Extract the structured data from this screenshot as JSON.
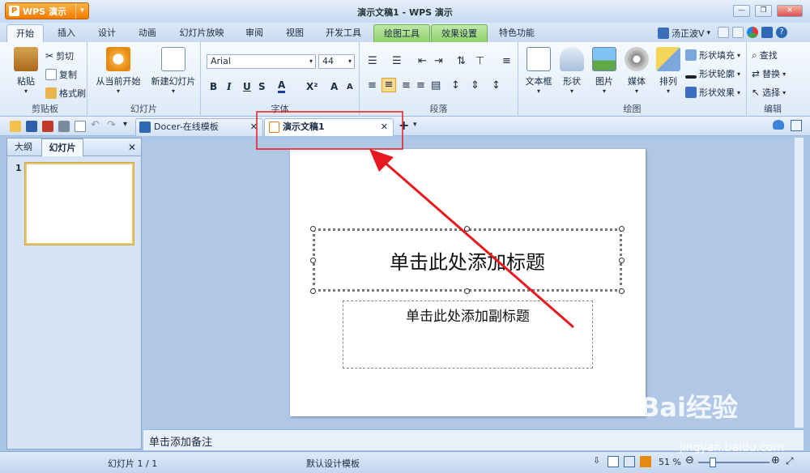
{
  "app": {
    "menu_label": "WPS 演示",
    "window_title": "演示文稿1 - WPS 演示"
  },
  "ribbon_tabs": [
    {
      "label": "开始"
    },
    {
      "label": "插入"
    },
    {
      "label": "设计"
    },
    {
      "label": "动画"
    },
    {
      "label": "幻灯片放映"
    },
    {
      "label": "审阅"
    },
    {
      "label": "视图"
    },
    {
      "label": "开发工具"
    },
    {
      "label": "绘图工具"
    },
    {
      "label": "效果设置"
    },
    {
      "label": "特色功能"
    }
  ],
  "user_name": "汤正波V",
  "groups": {
    "clipboard": {
      "label": "剪贴板",
      "paste": "粘贴",
      "cut": "剪切",
      "copy": "复制",
      "format_painter": "格式刷"
    },
    "slides": {
      "label": "幻灯片",
      "from_current": "从当前开始",
      "new_slide": "新建幻灯片"
    },
    "font": {
      "label": "字体",
      "font_name": "Arial",
      "font_size": "44"
    },
    "paragraph": {
      "label": "段落"
    },
    "drawing": {
      "label": "绘图",
      "textbox": "文本框",
      "shape": "形状",
      "picture": "图片",
      "media": "媒体",
      "arrange": "排列",
      "shape_fill": "形状填充",
      "shape_outline": "形状轮廓",
      "shape_effect": "形状效果"
    },
    "editing": {
      "label": "编辑",
      "find": "查找",
      "replace": "替换",
      "select": "选择"
    }
  },
  "doc_tabs": [
    {
      "label": "Docer-在线模板"
    },
    {
      "label": "演示文稿1"
    }
  ],
  "pane_tabs": {
    "outline": "大纲",
    "slides": "幻灯片"
  },
  "thumb_number": "1",
  "slide": {
    "title_placeholder": "单击此处添加标题",
    "subtitle_placeholder": "单击此处添加副标题"
  },
  "notes_placeholder": "单击添加备注",
  "status": {
    "slide_count": "幻灯片 1 / 1",
    "template": "默认设计模板",
    "zoom": "51 %"
  },
  "watermark": {
    "text": "Bai经验",
    "url": "jingyan.baidu.com"
  },
  "colors": {
    "accent": "#f07c00",
    "annotation": "#e8191e"
  }
}
